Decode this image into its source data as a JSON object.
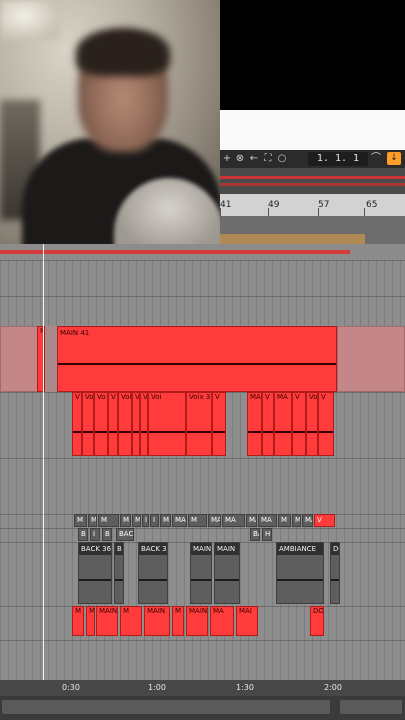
{
  "transport": {
    "position": "1.   1.   1",
    "follow_icon": "follow-arrow-icon",
    "buttons": [
      "+",
      "⊗",
      "←",
      "⛶",
      "○"
    ]
  },
  "ruler": {
    "marks": [
      "41",
      "49",
      "57",
      "65"
    ]
  },
  "tracks": {
    "main_clip": "MAIN 41",
    "voice_clips": [
      "V",
      "Vo",
      "Vo",
      "V",
      "Voi",
      "V",
      "V",
      "Voi",
      "Voix 3",
      "V",
      "MA",
      "V",
      "MA",
      "V",
      "Vo",
      "V"
    ],
    "small_labels": [
      "M",
      "M",
      "M",
      "M",
      "MA",
      "I",
      "I",
      "M",
      "MA",
      "M",
      "MA",
      "MA",
      "MA",
      "MA",
      "M",
      "M",
      "MAI",
      "V"
    ],
    "row_labels": [
      "B",
      "I",
      "B",
      "BAC",
      "BA",
      "H"
    ],
    "gray_titles": [
      "BACK 36",
      "B",
      "BACK 3",
      "MAIN",
      "MAIN",
      "AMBIANCE",
      "DO"
    ],
    "bottom_labels": [
      "M",
      "M",
      "MAIN",
      "M",
      "MAIN",
      "M",
      "MAIN",
      "MA",
      "MAI",
      "DO"
    ]
  },
  "timeline": {
    "labels": [
      "0:30",
      "1:00",
      "1:30",
      "2:00"
    ]
  },
  "colors": {
    "clip_red": "#ff3b3b",
    "follow_orange": "#ff9d2a",
    "loop_brace": "#b08a55"
  }
}
